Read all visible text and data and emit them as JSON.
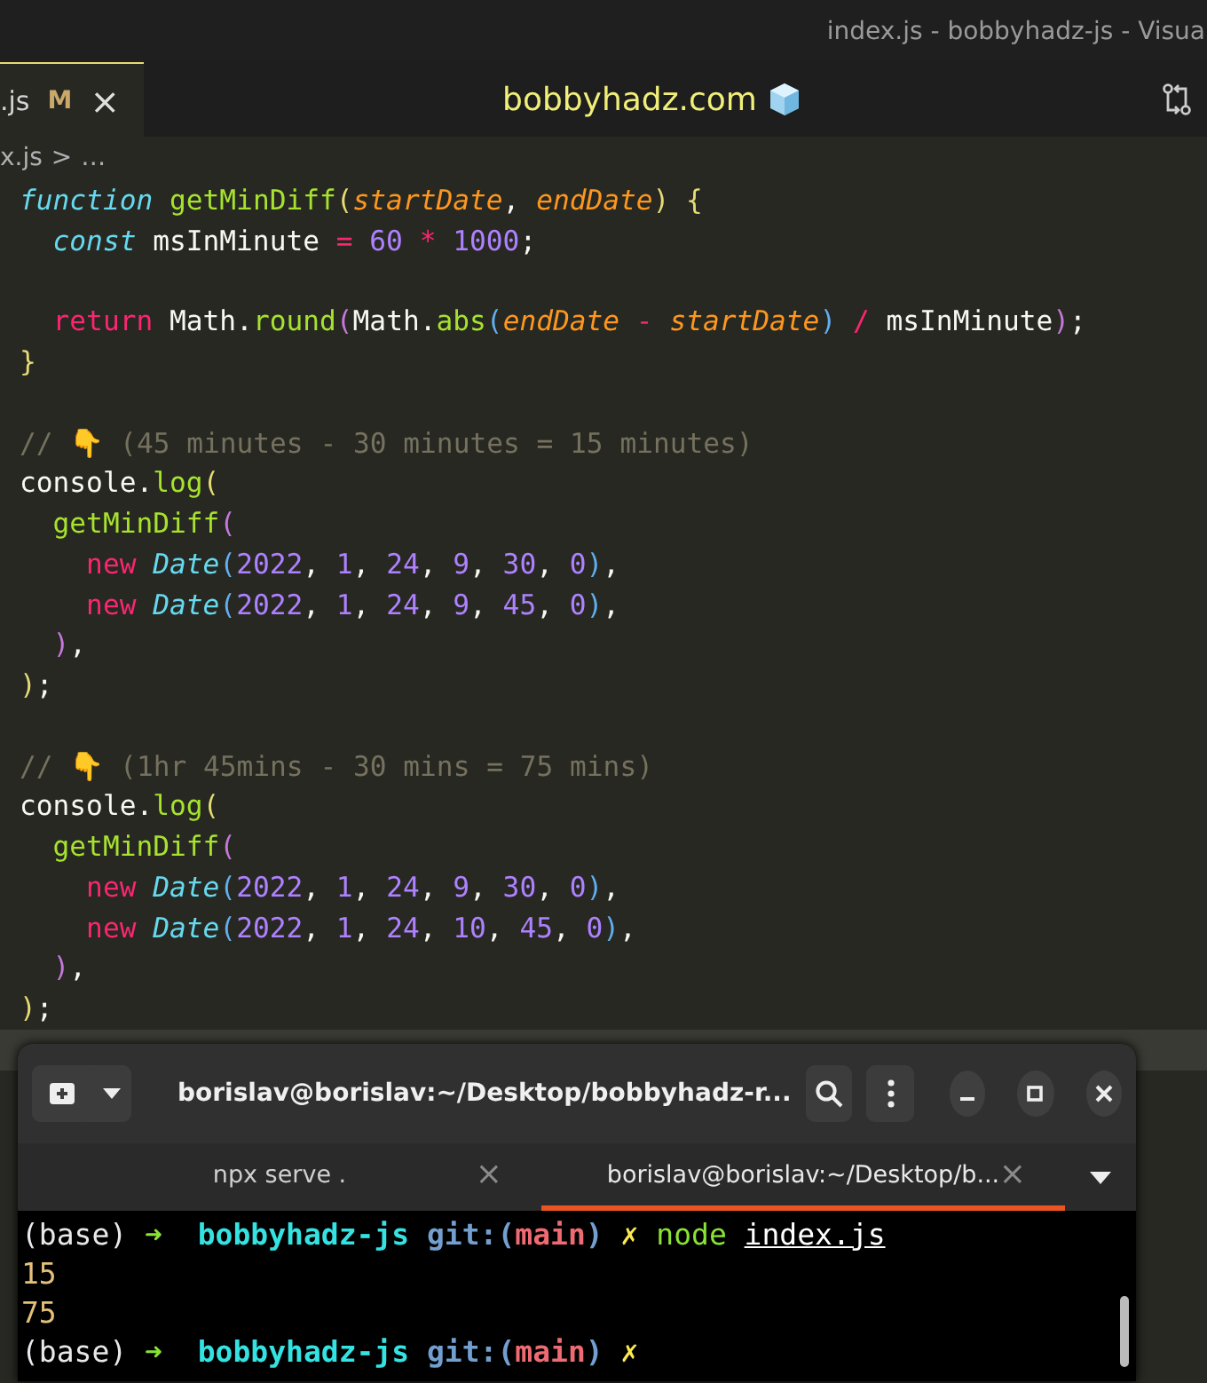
{
  "window": {
    "title": "index.js - bobbyhadz-js - Visua"
  },
  "tabs": [
    {
      "label": ".js",
      "badge": "M",
      "close": "×",
      "selected": true
    }
  ],
  "brand": {
    "text": "bobbyhadz.com"
  },
  "breadcrumb": {
    "file": "x.js",
    "separator": ">",
    "rest": "…"
  },
  "code_lines": [
    {
      "kind": "code",
      "tokens": [
        {
          "text": "function",
          "kind": "storage"
        },
        {
          "text": " getMinDiff",
          "kind": "fn"
        },
        {
          "text": "(",
          "kind": "p1"
        },
        {
          "text": "startDate",
          "kind": "param"
        },
        {
          "text": ", ",
          "kind": "plain"
        },
        {
          "text": "endDate",
          "kind": "param"
        },
        {
          "text": ")",
          "kind": "p1"
        },
        {
          "text": " {",
          "kind": "p1"
        }
      ]
    },
    {
      "kind": "code",
      "tokens": [
        {
          "text": "  const",
          "kind": "storage"
        },
        {
          "text": " msInMinute",
          "kind": "plain"
        },
        {
          "text": " =",
          "kind": "op"
        },
        {
          "text": " 60",
          "kind": "num"
        },
        {
          "text": " *",
          "kind": "op"
        },
        {
          "text": " 1000",
          "kind": "num"
        },
        {
          "text": ";",
          "kind": "plain"
        }
      ]
    },
    {
      "kind": "blank"
    },
    {
      "kind": "code",
      "tokens": [
        {
          "text": "  return",
          "kind": "kw"
        },
        {
          "text": " Math.",
          "kind": "plain"
        },
        {
          "text": "round",
          "kind": "fn"
        },
        {
          "text": "(",
          "kind": "p2"
        },
        {
          "text": "Math.",
          "kind": "plain"
        },
        {
          "text": "abs",
          "kind": "fn"
        },
        {
          "text": "(",
          "kind": "p3"
        },
        {
          "text": "endDate",
          "kind": "param"
        },
        {
          "text": " -",
          "kind": "op"
        },
        {
          "text": " startDate",
          "kind": "param"
        },
        {
          "text": ")",
          "kind": "p3"
        },
        {
          "text": " /",
          "kind": "op"
        },
        {
          "text": " msInMinute",
          "kind": "plain"
        },
        {
          "text": ")",
          "kind": "p2"
        },
        {
          "text": ";",
          "kind": "plain"
        }
      ]
    },
    {
      "kind": "code",
      "tokens": [
        {
          "text": "}",
          "kind": "p1"
        }
      ]
    },
    {
      "kind": "blank"
    },
    {
      "kind": "code",
      "tokens": [
        {
          "text": "// 👇 (45 minutes - 30 minutes = 15 minutes)",
          "kind": "comment"
        }
      ]
    },
    {
      "kind": "code",
      "tokens": [
        {
          "text": "console.",
          "kind": "plain"
        },
        {
          "text": "log",
          "kind": "fn"
        },
        {
          "text": "(",
          "kind": "p1"
        }
      ]
    },
    {
      "kind": "code",
      "tokens": [
        {
          "text": "  getMinDiff",
          "kind": "fn"
        },
        {
          "text": "(",
          "kind": "p2"
        }
      ]
    },
    {
      "kind": "code",
      "tokens": [
        {
          "text": "    new",
          "kind": "kw"
        },
        {
          "text": " Date",
          "kind": "cls"
        },
        {
          "text": "(",
          "kind": "p3"
        },
        {
          "text": "2022",
          "kind": "num"
        },
        {
          "text": ",",
          "kind": "plain"
        },
        {
          "text": " 1",
          "kind": "num"
        },
        {
          "text": ",",
          "kind": "plain"
        },
        {
          "text": " 24",
          "kind": "num"
        },
        {
          "text": ",",
          "kind": "plain"
        },
        {
          "text": " 9",
          "kind": "num"
        },
        {
          "text": ",",
          "kind": "plain"
        },
        {
          "text": " 30",
          "kind": "num"
        },
        {
          "text": ",",
          "kind": "plain"
        },
        {
          "text": " 0",
          "kind": "num"
        },
        {
          "text": ")",
          "kind": "p3"
        },
        {
          "text": ",",
          "kind": "plain"
        }
      ]
    },
    {
      "kind": "code",
      "tokens": [
        {
          "text": "    new",
          "kind": "kw"
        },
        {
          "text": " Date",
          "kind": "cls"
        },
        {
          "text": "(",
          "kind": "p3"
        },
        {
          "text": "2022",
          "kind": "num"
        },
        {
          "text": ",",
          "kind": "plain"
        },
        {
          "text": " 1",
          "kind": "num"
        },
        {
          "text": ",",
          "kind": "plain"
        },
        {
          "text": " 24",
          "kind": "num"
        },
        {
          "text": ",",
          "kind": "plain"
        },
        {
          "text": " 9",
          "kind": "num"
        },
        {
          "text": ",",
          "kind": "plain"
        },
        {
          "text": " 45",
          "kind": "num"
        },
        {
          "text": ",",
          "kind": "plain"
        },
        {
          "text": " 0",
          "kind": "num"
        },
        {
          "text": ")",
          "kind": "p3"
        },
        {
          "text": ",",
          "kind": "plain"
        }
      ]
    },
    {
      "kind": "code",
      "tokens": [
        {
          "text": "  )",
          "kind": "p2"
        },
        {
          "text": ",",
          "kind": "plain"
        }
      ]
    },
    {
      "kind": "code",
      "tokens": [
        {
          "text": ")",
          "kind": "p1"
        },
        {
          "text": ";",
          "kind": "plain"
        }
      ]
    },
    {
      "kind": "blank"
    },
    {
      "kind": "code",
      "tokens": [
        {
          "text": "// 👇 (1hr 45mins - 30 mins = 75 mins)",
          "kind": "comment"
        }
      ]
    },
    {
      "kind": "code",
      "tokens": [
        {
          "text": "console.",
          "kind": "plain"
        },
        {
          "text": "log",
          "kind": "fn"
        },
        {
          "text": "(",
          "kind": "p1"
        }
      ]
    },
    {
      "kind": "code",
      "tokens": [
        {
          "text": "  getMinDiff",
          "kind": "fn"
        },
        {
          "text": "(",
          "kind": "p2"
        }
      ]
    },
    {
      "kind": "code",
      "tokens": [
        {
          "text": "    new",
          "kind": "kw"
        },
        {
          "text": " Date",
          "kind": "cls"
        },
        {
          "text": "(",
          "kind": "p3"
        },
        {
          "text": "2022",
          "kind": "num"
        },
        {
          "text": ",",
          "kind": "plain"
        },
        {
          "text": " 1",
          "kind": "num"
        },
        {
          "text": ",",
          "kind": "plain"
        },
        {
          "text": " 24",
          "kind": "num"
        },
        {
          "text": ",",
          "kind": "plain"
        },
        {
          "text": " 9",
          "kind": "num"
        },
        {
          "text": ",",
          "kind": "plain"
        },
        {
          "text": " 30",
          "kind": "num"
        },
        {
          "text": ",",
          "kind": "plain"
        },
        {
          "text": " 0",
          "kind": "num"
        },
        {
          "text": ")",
          "kind": "p3"
        },
        {
          "text": ",",
          "kind": "plain"
        }
      ]
    },
    {
      "kind": "code",
      "tokens": [
        {
          "text": "    new",
          "kind": "kw"
        },
        {
          "text": " Date",
          "kind": "cls"
        },
        {
          "text": "(",
          "kind": "p3"
        },
        {
          "text": "2022",
          "kind": "num"
        },
        {
          "text": ",",
          "kind": "plain"
        },
        {
          "text": " 1",
          "kind": "num"
        },
        {
          "text": ",",
          "kind": "plain"
        },
        {
          "text": " 24",
          "kind": "num"
        },
        {
          "text": ",",
          "kind": "plain"
        },
        {
          "text": " 10",
          "kind": "num"
        },
        {
          "text": ",",
          "kind": "plain"
        },
        {
          "text": " 45",
          "kind": "num"
        },
        {
          "text": ",",
          "kind": "plain"
        },
        {
          "text": " 0",
          "kind": "num"
        },
        {
          "text": ")",
          "kind": "p3"
        },
        {
          "text": ",",
          "kind": "plain"
        }
      ]
    },
    {
      "kind": "code",
      "tokens": [
        {
          "text": "  )",
          "kind": "p2"
        },
        {
          "text": ",",
          "kind": "plain"
        }
      ]
    },
    {
      "kind": "code",
      "tokens": [
        {
          "text": ")",
          "kind": "p1"
        },
        {
          "text": ";",
          "kind": "plain"
        }
      ]
    },
    {
      "kind": "current"
    }
  ],
  "terminal": {
    "title": "borislav@borislav:~/Desktop/bobbyhadz-r...",
    "tabs": [
      {
        "label": "npx serve .",
        "close": "×",
        "selected": false
      },
      {
        "label": "borislav@borislav:~/Desktop/b...",
        "close": "×",
        "selected": true
      }
    ],
    "lines": [
      [
        {
          "text": "(base)",
          "kind": "plain"
        },
        {
          "text": " ➜",
          "kind": "arrow"
        },
        {
          "text": "  bobbyhadz-js",
          "kind": "dir"
        },
        {
          "text": " git:(",
          "kind": "git"
        },
        {
          "text": "main",
          "kind": "branch"
        },
        {
          "text": ")",
          "kind": "git"
        },
        {
          "text": " ✗",
          "kind": "dirty"
        },
        {
          "text": " node",
          "kind": "cmd"
        },
        {
          "text": "index.js",
          "kind": "path"
        }
      ],
      [
        {
          "text": "15",
          "kind": "out"
        }
      ],
      [
        {
          "text": "75",
          "kind": "out"
        }
      ],
      [
        {
          "text": "(base)",
          "kind": "plain"
        },
        {
          "text": " ➜",
          "kind": "arrow"
        },
        {
          "text": "  bobbyhadz-js",
          "kind": "dir"
        },
        {
          "text": " git:(",
          "kind": "git"
        },
        {
          "text": "main",
          "kind": "branch"
        },
        {
          "text": ")",
          "kind": "git"
        },
        {
          "text": " ✗",
          "kind": "dirty"
        }
      ]
    ]
  }
}
